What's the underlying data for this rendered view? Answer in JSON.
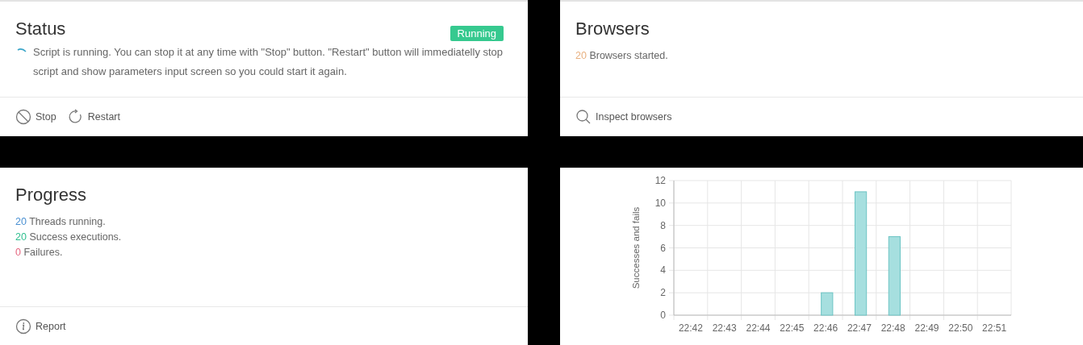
{
  "status": {
    "title": "Status",
    "badge": {
      "label": "Running",
      "color": "#36c98f"
    },
    "message": "Script is running. You can stop it at any time with \"Stop\" button. \"Restart\" button will immediatelly stop script and show parameters input screen so you could start it again.",
    "actions": [
      {
        "kind": "stop",
        "label": "Stop"
      },
      {
        "kind": "restart",
        "label": "Restart"
      }
    ]
  },
  "browsers": {
    "title": "Browsers",
    "lines": [
      {
        "value": "20",
        "text": "Browsers started.",
        "color": "#e8b07f"
      }
    ],
    "actions": [
      {
        "kind": "inspect",
        "label": "Inspect browsers"
      }
    ]
  },
  "progress": {
    "title": "Progress",
    "lines": [
      {
        "value": "20",
        "text": "Threads running.",
        "color": "#4a90d2"
      },
      {
        "value": "20",
        "text": "Success executions.",
        "color": "#2fbf8f"
      },
      {
        "value": "0",
        "text": "Failures.",
        "color": "#e5657f"
      }
    ],
    "actions": [
      {
        "kind": "report",
        "label": "Report"
      }
    ]
  },
  "chart": {
    "chart_data": {
      "type": "bar",
      "ylabel": "Successes and fails",
      "categories": [
        "22:42",
        "22:43",
        "22:44",
        "22:45",
        "22:46",
        "22:47",
        "22:48",
        "22:49",
        "22:50",
        "22:51"
      ],
      "ylim": [
        0,
        12
      ],
      "yticks": [
        0,
        2,
        4,
        6,
        8,
        10,
        12
      ],
      "grid": true,
      "series": [
        {
          "color": "#a6dfdf",
          "values": [
            0,
            0,
            0,
            0,
            2,
            11,
            7,
            0,
            0,
            0
          ]
        }
      ]
    }
  }
}
